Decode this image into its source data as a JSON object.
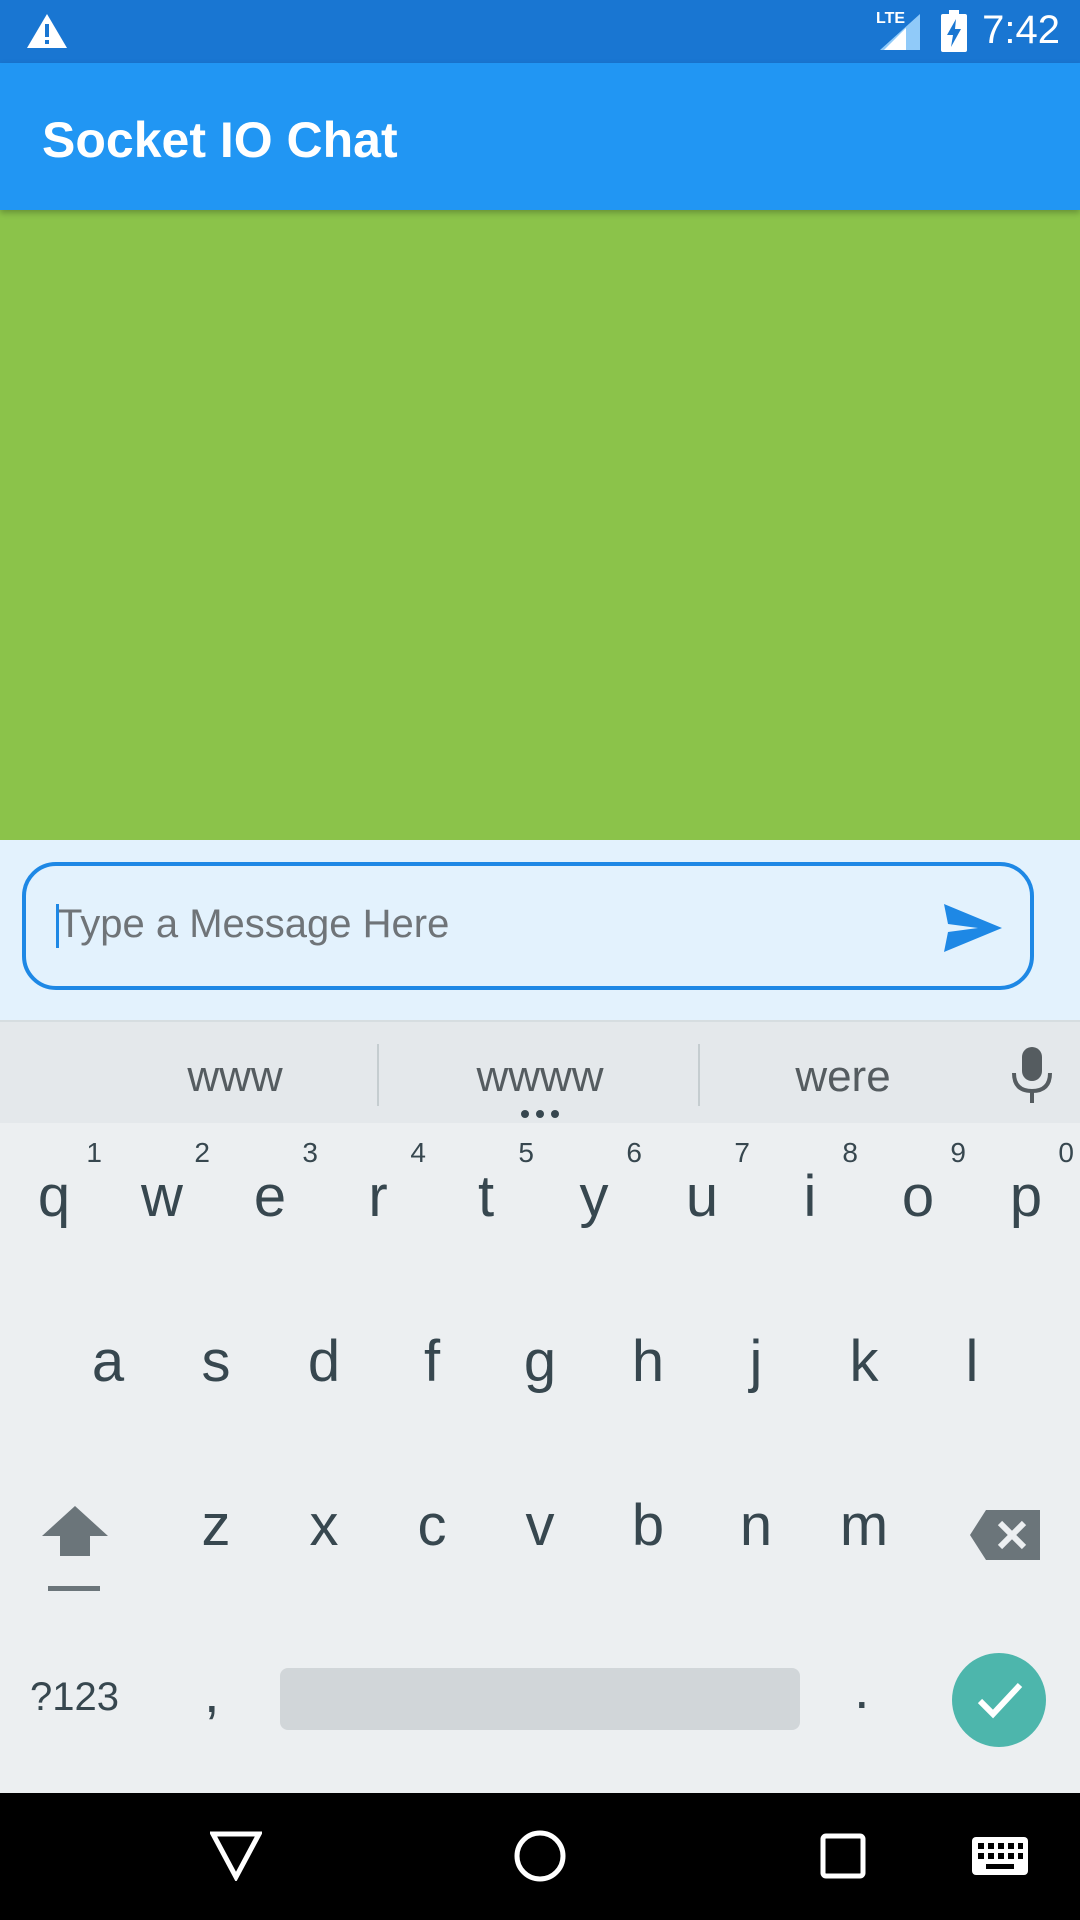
{
  "status_bar": {
    "time": "7:42",
    "network": "LTE"
  },
  "app_bar": {
    "title": "Socket IO Chat"
  },
  "composer": {
    "placeholder": "Type a Message Here"
  },
  "keyboard": {
    "suggestions": [
      "www",
      "wwww",
      "were"
    ],
    "row1": [
      {
        "k": "q",
        "n": "1"
      },
      {
        "k": "w",
        "n": "2"
      },
      {
        "k": "e",
        "n": "3"
      },
      {
        "k": "r",
        "n": "4"
      },
      {
        "k": "t",
        "n": "5"
      },
      {
        "k": "y",
        "n": "6"
      },
      {
        "k": "u",
        "n": "7"
      },
      {
        "k": "i",
        "n": "8"
      },
      {
        "k": "o",
        "n": "9"
      },
      {
        "k": "p",
        "n": "0"
      }
    ],
    "row2": [
      "a",
      "s",
      "d",
      "f",
      "g",
      "h",
      "j",
      "k",
      "l"
    ],
    "row3": [
      "z",
      "x",
      "c",
      "v",
      "b",
      "n",
      "m"
    ],
    "symbols_label": "?123",
    "comma": ",",
    "period": "."
  },
  "colors": {
    "status_bar": "#1976d2",
    "app_bar": "#2196f3",
    "chat_area": "#8bc34a",
    "accent": "#1e88e5",
    "enter": "#4db6ac"
  },
  "icons": [
    "warning-icon",
    "signal-icon",
    "battery-charging-icon",
    "send-icon",
    "mic-icon",
    "shift-icon",
    "backspace-icon",
    "check-icon",
    "back-icon",
    "home-icon",
    "recents-icon",
    "keyboard-switch-icon"
  ]
}
